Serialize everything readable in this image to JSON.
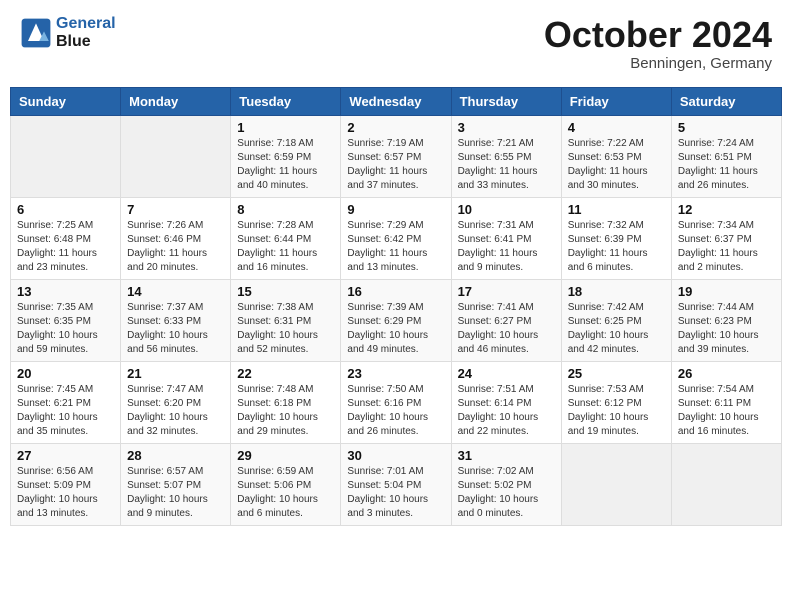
{
  "header": {
    "logo_line1": "General",
    "logo_line2": "Blue",
    "month": "October 2024",
    "location": "Benningen, Germany"
  },
  "days_of_week": [
    "Sunday",
    "Monday",
    "Tuesday",
    "Wednesday",
    "Thursday",
    "Friday",
    "Saturday"
  ],
  "weeks": [
    [
      {
        "num": "",
        "info": ""
      },
      {
        "num": "",
        "info": ""
      },
      {
        "num": "1",
        "info": "Sunrise: 7:18 AM\nSunset: 6:59 PM\nDaylight: 11 hours and 40 minutes."
      },
      {
        "num": "2",
        "info": "Sunrise: 7:19 AM\nSunset: 6:57 PM\nDaylight: 11 hours and 37 minutes."
      },
      {
        "num": "3",
        "info": "Sunrise: 7:21 AM\nSunset: 6:55 PM\nDaylight: 11 hours and 33 minutes."
      },
      {
        "num": "4",
        "info": "Sunrise: 7:22 AM\nSunset: 6:53 PM\nDaylight: 11 hours and 30 minutes."
      },
      {
        "num": "5",
        "info": "Sunrise: 7:24 AM\nSunset: 6:51 PM\nDaylight: 11 hours and 26 minutes."
      }
    ],
    [
      {
        "num": "6",
        "info": "Sunrise: 7:25 AM\nSunset: 6:48 PM\nDaylight: 11 hours and 23 minutes."
      },
      {
        "num": "7",
        "info": "Sunrise: 7:26 AM\nSunset: 6:46 PM\nDaylight: 11 hours and 20 minutes."
      },
      {
        "num": "8",
        "info": "Sunrise: 7:28 AM\nSunset: 6:44 PM\nDaylight: 11 hours and 16 minutes."
      },
      {
        "num": "9",
        "info": "Sunrise: 7:29 AM\nSunset: 6:42 PM\nDaylight: 11 hours and 13 minutes."
      },
      {
        "num": "10",
        "info": "Sunrise: 7:31 AM\nSunset: 6:41 PM\nDaylight: 11 hours and 9 minutes."
      },
      {
        "num": "11",
        "info": "Sunrise: 7:32 AM\nSunset: 6:39 PM\nDaylight: 11 hours and 6 minutes."
      },
      {
        "num": "12",
        "info": "Sunrise: 7:34 AM\nSunset: 6:37 PM\nDaylight: 11 hours and 2 minutes."
      }
    ],
    [
      {
        "num": "13",
        "info": "Sunrise: 7:35 AM\nSunset: 6:35 PM\nDaylight: 10 hours and 59 minutes."
      },
      {
        "num": "14",
        "info": "Sunrise: 7:37 AM\nSunset: 6:33 PM\nDaylight: 10 hours and 56 minutes."
      },
      {
        "num": "15",
        "info": "Sunrise: 7:38 AM\nSunset: 6:31 PM\nDaylight: 10 hours and 52 minutes."
      },
      {
        "num": "16",
        "info": "Sunrise: 7:39 AM\nSunset: 6:29 PM\nDaylight: 10 hours and 49 minutes."
      },
      {
        "num": "17",
        "info": "Sunrise: 7:41 AM\nSunset: 6:27 PM\nDaylight: 10 hours and 46 minutes."
      },
      {
        "num": "18",
        "info": "Sunrise: 7:42 AM\nSunset: 6:25 PM\nDaylight: 10 hours and 42 minutes."
      },
      {
        "num": "19",
        "info": "Sunrise: 7:44 AM\nSunset: 6:23 PM\nDaylight: 10 hours and 39 minutes."
      }
    ],
    [
      {
        "num": "20",
        "info": "Sunrise: 7:45 AM\nSunset: 6:21 PM\nDaylight: 10 hours and 35 minutes."
      },
      {
        "num": "21",
        "info": "Sunrise: 7:47 AM\nSunset: 6:20 PM\nDaylight: 10 hours and 32 minutes."
      },
      {
        "num": "22",
        "info": "Sunrise: 7:48 AM\nSunset: 6:18 PM\nDaylight: 10 hours and 29 minutes."
      },
      {
        "num": "23",
        "info": "Sunrise: 7:50 AM\nSunset: 6:16 PM\nDaylight: 10 hours and 26 minutes."
      },
      {
        "num": "24",
        "info": "Sunrise: 7:51 AM\nSunset: 6:14 PM\nDaylight: 10 hours and 22 minutes."
      },
      {
        "num": "25",
        "info": "Sunrise: 7:53 AM\nSunset: 6:12 PM\nDaylight: 10 hours and 19 minutes."
      },
      {
        "num": "26",
        "info": "Sunrise: 7:54 AM\nSunset: 6:11 PM\nDaylight: 10 hours and 16 minutes."
      }
    ],
    [
      {
        "num": "27",
        "info": "Sunrise: 6:56 AM\nSunset: 5:09 PM\nDaylight: 10 hours and 13 minutes."
      },
      {
        "num": "28",
        "info": "Sunrise: 6:57 AM\nSunset: 5:07 PM\nDaylight: 10 hours and 9 minutes."
      },
      {
        "num": "29",
        "info": "Sunrise: 6:59 AM\nSunset: 5:06 PM\nDaylight: 10 hours and 6 minutes."
      },
      {
        "num": "30",
        "info": "Sunrise: 7:01 AM\nSunset: 5:04 PM\nDaylight: 10 hours and 3 minutes."
      },
      {
        "num": "31",
        "info": "Sunrise: 7:02 AM\nSunset: 5:02 PM\nDaylight: 10 hours and 0 minutes."
      },
      {
        "num": "",
        "info": ""
      },
      {
        "num": "",
        "info": ""
      }
    ]
  ]
}
